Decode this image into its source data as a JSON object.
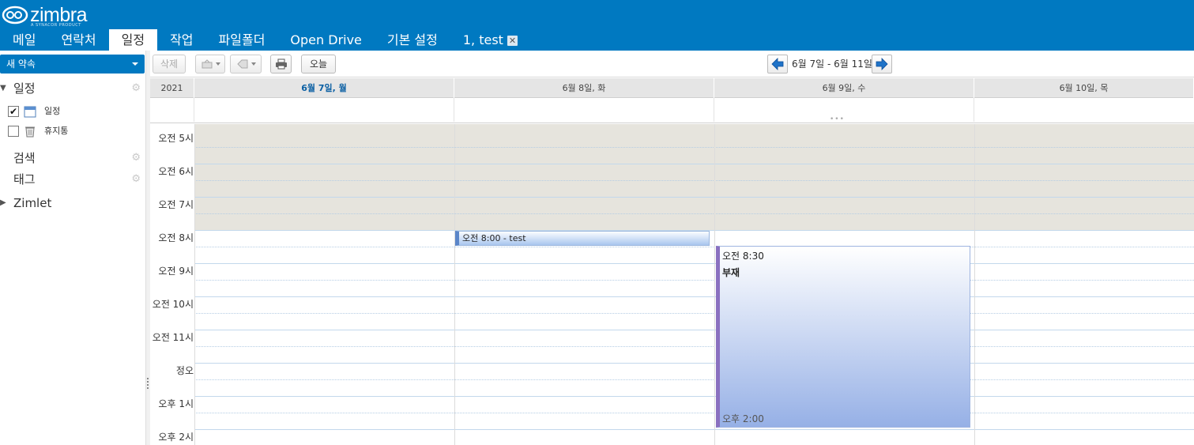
{
  "app": {
    "logo_text": "zimbra",
    "logo_sub": "A SYNACOR PRODUCT"
  },
  "tabs": [
    {
      "label": "메일"
    },
    {
      "label": "연락처"
    },
    {
      "label": "일정",
      "active": true
    },
    {
      "label": "작업"
    },
    {
      "label": "파일폴더"
    },
    {
      "label": "Open Drive"
    },
    {
      "label": "기본 설정"
    },
    {
      "label": "1, test",
      "closable": true
    }
  ],
  "sidebar": {
    "new_button": "새 약속",
    "sections": {
      "calendar": {
        "label": "일정",
        "expanded": true
      },
      "search": {
        "label": "검색"
      },
      "tags": {
        "label": "태그"
      },
      "zimlet": {
        "label": "Zimlet",
        "expanded": false
      }
    },
    "items": [
      {
        "label": "일정",
        "checked": true,
        "icon": "calendar-icon"
      },
      {
        "label": "휴지통",
        "checked": false,
        "icon": "trash-icon"
      }
    ]
  },
  "toolbar": {
    "delete_label": "삭제",
    "today_label": "오늘",
    "date_range": "6월 7일 - 6월 11일"
  },
  "calendar": {
    "year": "2021",
    "days": [
      {
        "label": "6월 7일, 월",
        "today": true
      },
      {
        "label": "6월 8일, 화"
      },
      {
        "label": "6월 9일, 수"
      },
      {
        "label": "6월 10일, 목"
      }
    ],
    "hours": [
      "오전 5시",
      "오전 6시",
      "오전 7시",
      "오전 8시",
      "오전 9시",
      "오전 10시",
      "오전 11시",
      "정오",
      "오후 1시",
      "오후 2시"
    ],
    "appointments": [
      {
        "text": "오전 8:00 - test",
        "day": 1
      },
      {
        "start": "오전 8:30",
        "title": "부재",
        "end": "오후 2:00",
        "day": 2
      }
    ]
  },
  "colors": {
    "brand": "#0079c1",
    "offhours": "#e6e4dd"
  }
}
